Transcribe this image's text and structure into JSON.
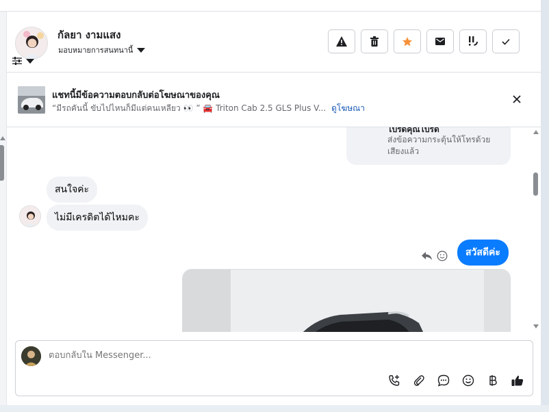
{
  "contact": {
    "name": "กัลยา งามแสง",
    "assign_label": "มอบหมายการสนทนานี้"
  },
  "actions": [
    "spam-icon",
    "trash-icon",
    "star-icon",
    "mail-icon",
    "priority-icon",
    "check-icon"
  ],
  "ad_banner": {
    "title": "แชทนี้มีข้อความตอบกลับต่อโฆษณาของคุณ",
    "subtitle": "“มีรถคันนี้ ขับไปไหนก็มีแต่คนเหลียว 👀 ” 🚘 Triton Cab 2.5 GLS Plus V...",
    "link": "ดูโฆษณา"
  },
  "messages": {
    "call_card_title": "โปรดคุณโปรด",
    "call_card_desc": "ส่งข้อความกระตุ้นให้โทรด้วยเสียงแล้ว",
    "incoming": [
      "สนใจค่ะ",
      "ไม่มีเครดิตได้ไหมคะ"
    ],
    "outgoing": "สวัสดีค่ะ"
  },
  "composer": {
    "placeholder": "ตอบกลับใน Messenger..."
  },
  "colors": {
    "accent": "#0a7cff",
    "star": "#f7923a",
    "link": "#1a5ab6"
  }
}
